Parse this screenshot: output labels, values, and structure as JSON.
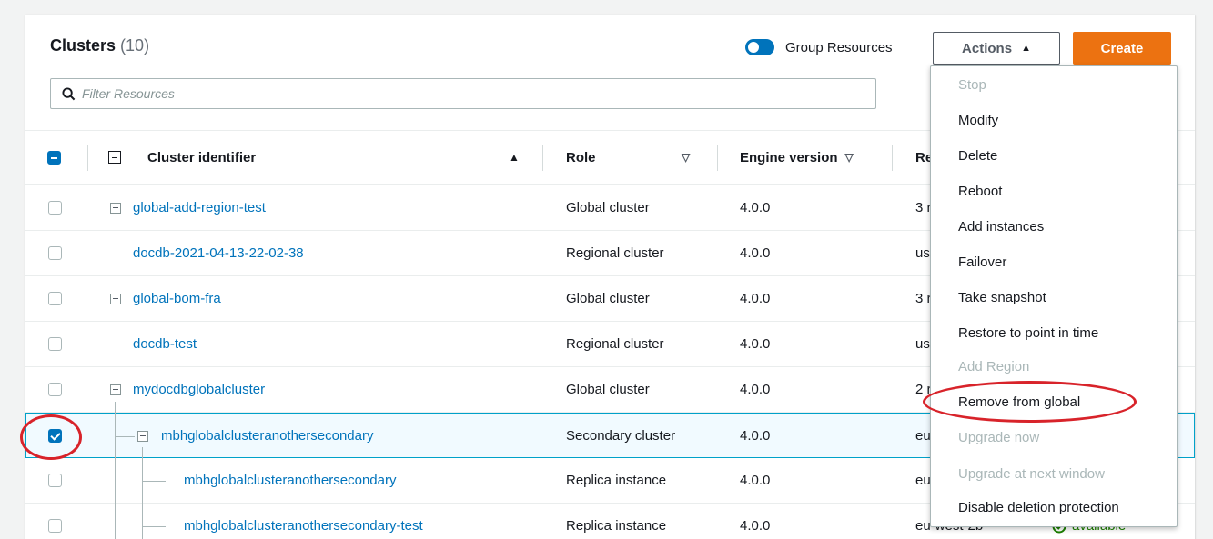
{
  "header": {
    "title": "Clusters",
    "count": "(10)"
  },
  "toggle": {
    "label": "Group Resources",
    "on": true
  },
  "buttons": {
    "actions": "Actions",
    "create": "Create"
  },
  "search": {
    "placeholder": "Filter Resources"
  },
  "columns": {
    "identifier": "Cluster identifier",
    "role": "Role",
    "engine": "Engine version",
    "region": "Re"
  },
  "rows": [
    {
      "id": "global-add-region-test",
      "role": "Global cluster",
      "engine": "4.0.0",
      "region": "3 r",
      "checked": false
    },
    {
      "id": "docdb-2021-04-13-22-02-38",
      "role": "Regional cluster",
      "engine": "4.0.0",
      "region": "us-",
      "checked": false
    },
    {
      "id": "global-bom-fra",
      "role": "Global cluster",
      "engine": "4.0.0",
      "region": "3 r",
      "checked": false
    },
    {
      "id": "docdb-test",
      "role": "Regional cluster",
      "engine": "4.0.0",
      "region": "us-",
      "checked": false
    },
    {
      "id": "mydocdbglobalcluster",
      "role": "Global cluster",
      "engine": "4.0.0",
      "region": "2 r",
      "checked": false
    },
    {
      "id": "mbhglobalclusteranothersecondary",
      "role": "Secondary cluster",
      "engine": "4.0.0",
      "region": "eu",
      "checked": true
    },
    {
      "id": "mbhglobalclusteranothersecondary",
      "role": "Replica instance",
      "engine": "4.0.0",
      "region": "eu",
      "checked": false
    },
    {
      "id": "mbhglobalclusteranothersecondary-test",
      "role": "Replica instance",
      "engine": "4.0.0",
      "region": "eu-west-2b",
      "status": "available",
      "checked": false
    }
  ],
  "menu": [
    {
      "label": "Stop",
      "disabled": true
    },
    {
      "label": "Modify",
      "disabled": false
    },
    {
      "label": "Delete",
      "disabled": false
    },
    {
      "label": "Reboot",
      "disabled": false
    },
    {
      "label": "Add instances",
      "disabled": false
    },
    {
      "label": "Failover",
      "disabled": false
    },
    {
      "label": "Take snapshot",
      "disabled": false
    },
    {
      "label": "Restore to point in time",
      "disabled": false
    },
    {
      "label": "Add Region",
      "disabled": true
    },
    {
      "label": "Remove from global",
      "disabled": false
    },
    {
      "label": "Upgrade now",
      "disabled": true
    },
    {
      "label": "Upgrade at next window",
      "disabled": true
    },
    {
      "label": "Disable deletion protection",
      "disabled": false
    }
  ],
  "colors": {
    "link": "#0073bb",
    "primary": "#ec7211",
    "annotation": "#d8232a",
    "success": "#1d8102"
  }
}
